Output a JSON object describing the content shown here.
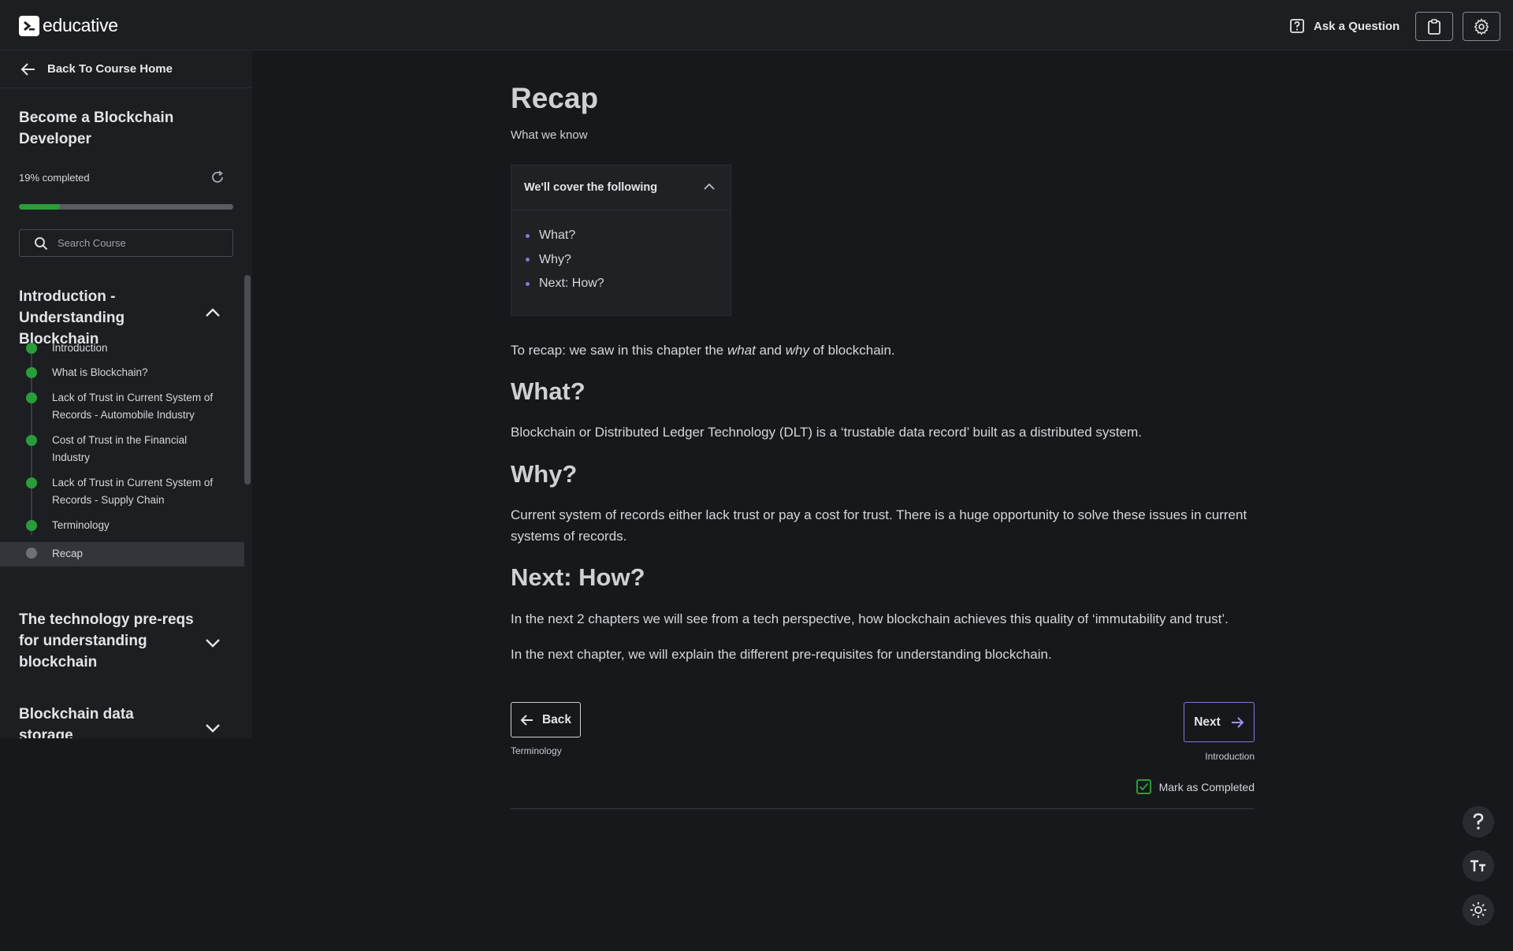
{
  "header": {
    "logo_text": "educative",
    "ask_label": "Ask a Question"
  },
  "sidebar": {
    "back_label": "Back To Course Home",
    "course_title": "Become a Blockchain Developer",
    "progress_text": "19% completed",
    "progress_fraction": 0.19,
    "search_placeholder": "Search Course",
    "chapters": [
      {
        "title": "Introduction - Understanding Blockchain",
        "expanded": true,
        "lessons": [
          {
            "label": "Introduction",
            "completed": true
          },
          {
            "label": "What is Blockchain?",
            "completed": true
          },
          {
            "label": "Lack of Trust in Current System of Records - Automobile Industry",
            "completed": true
          },
          {
            "label": "Cost of Trust in the Financial Industry",
            "completed": true
          },
          {
            "label": "Lack of Trust in Current System of Records - Supply Chain",
            "completed": true
          },
          {
            "label": "Terminology",
            "completed": true
          },
          {
            "label": "Recap",
            "completed": false,
            "active": true
          }
        ]
      },
      {
        "title": "The technology pre-reqs for understanding blockchain",
        "expanded": false
      },
      {
        "title": "Blockchain data storage",
        "expanded": false
      }
    ]
  },
  "main": {
    "title": "Recap",
    "subtitle": "What we know",
    "cover": {
      "heading": "We'll cover the following",
      "items": [
        "What?",
        "Why?",
        "Next: How?"
      ]
    },
    "intro": {
      "before": "To recap: we saw in this chapter the ",
      "em1": "what",
      "mid": " and ",
      "em2": "why",
      "after": " of blockchain."
    },
    "sections": [
      {
        "heading": "What?",
        "paragraphs": [
          "Blockchain or Distributed Ledger Technology (DLT) is a ‘trustable data record’ built as a distributed system."
        ]
      },
      {
        "heading": "Why?",
        "paragraphs": [
          "Current system of records either lack trust or pay a cost for trust. There is a huge opportunity to solve these issues in current systems of records."
        ]
      },
      {
        "heading": "Next: How?",
        "paragraphs": [
          "In the next 2 chapters we will see from a tech perspective, how blockchain achieves this quality of ‘immutability and trust’.",
          "In the next chapter, we will explain the different pre-requisites for understanding blockchain."
        ]
      }
    ],
    "nav": {
      "back_label": "Back",
      "back_target": "Terminology",
      "next_label": "Next",
      "next_target": "Introduction",
      "mark_completed": "Mark as Completed",
      "mark_checked": true
    }
  },
  "colors": {
    "accent_green": "#2a9d3a",
    "accent_purple": "#7f7bd6",
    "background": "#17181c",
    "sidebar": "#1d1e22"
  }
}
